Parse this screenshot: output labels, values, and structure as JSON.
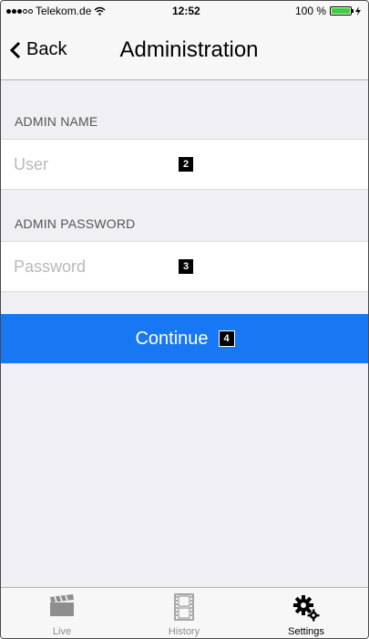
{
  "status_bar": {
    "carrier": "Telekom.de",
    "time": "12:52",
    "battery_text": "100 %"
  },
  "nav": {
    "back_label": "Back",
    "title": "Administration"
  },
  "form": {
    "admin_name_label": "ADMIN NAME",
    "admin_name_placeholder": "User",
    "admin_password_label": "ADMIN PASSWORD",
    "admin_password_placeholder": "Password",
    "continue_label": "Continue"
  },
  "markers": {
    "user": "2",
    "password": "3",
    "continue": "4"
  },
  "tabs": [
    {
      "label": "Live",
      "icon": "clapperboard-icon"
    },
    {
      "label": "History",
      "icon": "film-icon"
    },
    {
      "label": "Settings",
      "icon": "gears-icon",
      "active": true
    }
  ],
  "colors": {
    "accent": "#1877f2",
    "background": "#f0f0f4"
  }
}
